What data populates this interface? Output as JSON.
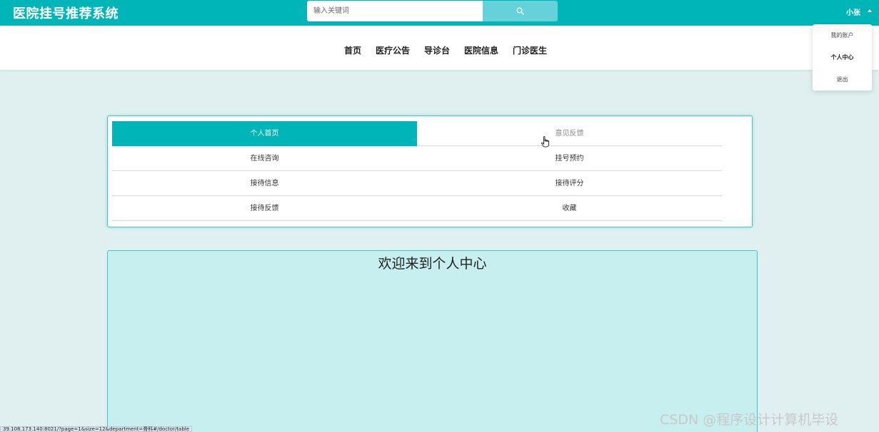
{
  "header": {
    "logo": "医院挂号推荐系统",
    "search_placeholder": "输入关键词",
    "user_name": "小张"
  },
  "user_menu": {
    "items": [
      {
        "label": "我的账户"
      },
      {
        "label": "个人中心"
      },
      {
        "label": "退出"
      }
    ]
  },
  "nav": {
    "items": [
      {
        "label": "首页"
      },
      {
        "label": "医疗公告"
      },
      {
        "label": "导诊台"
      },
      {
        "label": "医院信息"
      },
      {
        "label": "门诊医生"
      }
    ]
  },
  "center_menu": {
    "items": [
      {
        "label": "个人首页",
        "active": true
      },
      {
        "label": "意见反馈"
      },
      {
        "label": "在线咨询"
      },
      {
        "label": "挂号预约"
      },
      {
        "label": "接待信息"
      },
      {
        "label": "接待评分"
      },
      {
        "label": "接待反馈"
      },
      {
        "label": "收藏"
      }
    ]
  },
  "content": {
    "welcome": "欢迎来到个人中心"
  },
  "status_bar": {
    "url": "39.108.173.140:8021/?page=1&size=12&department=骨科#/doctor/table"
  },
  "watermark": "CSDN @程序设计计算机毕设",
  "colors": {
    "primary": "#00b5b8",
    "search_button": "#64d2d8",
    "page_background": "#e0f0f0",
    "content_background": "#c8efef"
  },
  "icons": {
    "search": "search-icon",
    "caret": "caret-up-icon",
    "cursor": "hand-cursor-icon"
  }
}
